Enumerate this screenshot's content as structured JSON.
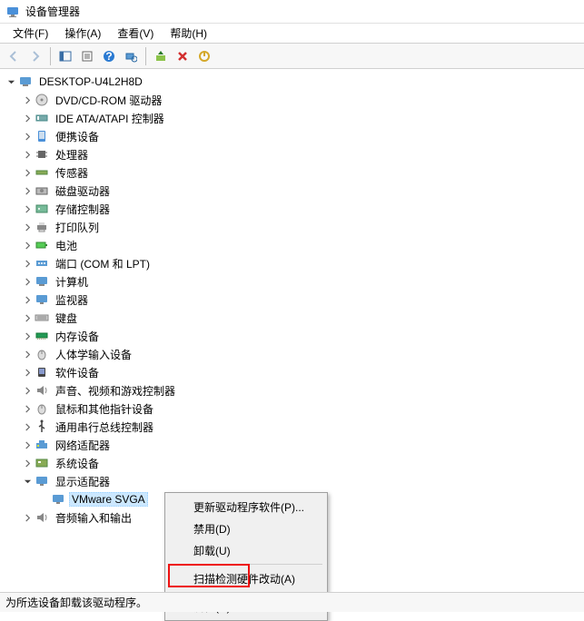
{
  "title": "设备管理器",
  "menubar": [
    {
      "label": "文件(F)"
    },
    {
      "label": "操作(A)"
    },
    {
      "label": "查看(V)"
    },
    {
      "label": "帮助(H)"
    }
  ],
  "toolbar": {
    "back": "back-icon",
    "forward": "forward-icon"
  },
  "root": {
    "label": "DESKTOP-U4L2H8D",
    "expanded": true
  },
  "categories": [
    {
      "label": "DVD/CD-ROM 驱动器",
      "icon": "cdrom-icon",
      "expanded": false
    },
    {
      "label": "IDE ATA/ATAPI 控制器",
      "icon": "ide-icon",
      "expanded": false
    },
    {
      "label": "便携设备",
      "icon": "portable-icon",
      "expanded": false
    },
    {
      "label": "处理器",
      "icon": "cpu-icon",
      "expanded": false
    },
    {
      "label": "传感器",
      "icon": "sensor-icon",
      "expanded": false
    },
    {
      "label": "磁盘驱动器",
      "icon": "disk-icon",
      "expanded": false
    },
    {
      "label": "存储控制器",
      "icon": "storage-icon",
      "expanded": false
    },
    {
      "label": "打印队列",
      "icon": "printer-icon",
      "expanded": false
    },
    {
      "label": "电池",
      "icon": "battery-icon",
      "expanded": false
    },
    {
      "label": "端口 (COM 和 LPT)",
      "icon": "port-icon",
      "expanded": false
    },
    {
      "label": "计算机",
      "icon": "computer-icon",
      "expanded": false
    },
    {
      "label": "监视器",
      "icon": "monitor-icon",
      "expanded": false
    },
    {
      "label": "键盘",
      "icon": "keyboard-icon",
      "expanded": false
    },
    {
      "label": "内存设备",
      "icon": "memory-icon",
      "expanded": false
    },
    {
      "label": "人体学输入设备",
      "icon": "hid-icon",
      "expanded": false
    },
    {
      "label": "软件设备",
      "icon": "software-icon",
      "expanded": false
    },
    {
      "label": "声音、视频和游戏控制器",
      "icon": "audio-icon",
      "expanded": false
    },
    {
      "label": "鼠标和其他指针设备",
      "icon": "mouse-icon",
      "expanded": false
    },
    {
      "label": "通用串行总线控制器",
      "icon": "usb-icon",
      "expanded": false
    },
    {
      "label": "网络适配器",
      "icon": "network-icon",
      "expanded": false
    },
    {
      "label": "系统设备",
      "icon": "system-icon",
      "expanded": false
    },
    {
      "label": "显示适配器",
      "icon": "display-icon",
      "expanded": true,
      "children": [
        {
          "label": "VMware SVGA",
          "icon": "display-device-icon",
          "selected": true
        }
      ]
    },
    {
      "label": "音频输入和输出",
      "icon": "audioio-icon",
      "expanded": false
    }
  ],
  "contextmenu": [
    {
      "label": "更新驱动程序软件(P)..."
    },
    {
      "label": "禁用(D)"
    },
    {
      "label": "卸载(U)",
      "highlighted": true
    },
    {
      "sep": true
    },
    {
      "label": "扫描检测硬件改动(A)"
    },
    {
      "sep": true
    },
    {
      "label": "属性(R)"
    }
  ],
  "statusbar": "为所选设备卸载该驱动程序。"
}
